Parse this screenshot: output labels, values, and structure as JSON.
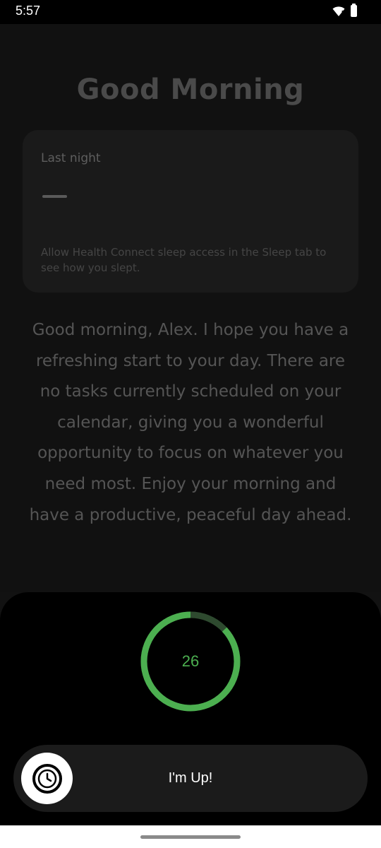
{
  "status_bar": {
    "time": "5:57"
  },
  "greeting": {
    "title": "Good Morning"
  },
  "sleep_card": {
    "label": "Last night",
    "value_placeholder": "—",
    "hint": "Allow Health Connect sleep access in the Sleep tab to see how you slept."
  },
  "message": {
    "text": "Good morning, Alex. I hope you have a refreshing start to your day. There are no tasks currently scheduled on your calendar, giving you a wonderful opportunity to focus on whatever you need most. Enjoy your morning and have a productive, peaceful day ahead."
  },
  "alarm_sheet": {
    "countdown": "26",
    "countdown_progress": 0.87,
    "slider_label": "I'm Up!",
    "slider_icon": "alarm-clock-icon"
  },
  "colors": {
    "accent_green": "#4caf50",
    "ring_track": "#2e4a2f"
  }
}
